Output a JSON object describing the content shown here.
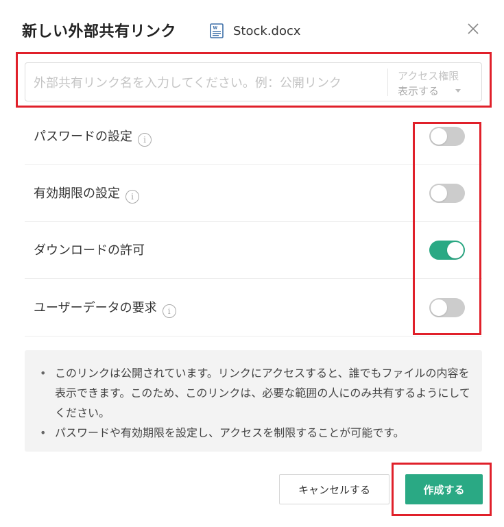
{
  "dialog": {
    "title": "新しい外部共有リンク",
    "file_name": "Stock.docx",
    "file_icon": "word-document-icon",
    "close_icon": "close-icon"
  },
  "link_name": {
    "value": "",
    "placeholder": "外部共有リンク名を入力してください。例：公開リンク",
    "access_label": "アクセス権限",
    "access_value": "表示する"
  },
  "settings": [
    {
      "label": "パスワードの設定",
      "info": true,
      "enabled": false
    },
    {
      "label": "有効期限の設定",
      "info": true,
      "enabled": false
    },
    {
      "label": "ダウンロードの許可",
      "info": false,
      "enabled": true
    },
    {
      "label": "ユーザーデータの要求",
      "info": true,
      "enabled": false
    }
  ],
  "info_glyph": "i",
  "notice": [
    "このリンクは公開されています。リンクにアクセスすると、誰でもファイルの内容を表示できます。このため、このリンクは、必要な範囲の人にのみ共有するようにしてください。",
    "パスワードや有効期限を設定し、アクセスを制限することが可能です。"
  ],
  "buttons": {
    "cancel": "キャンセルする",
    "create": "作成する"
  },
  "colors": {
    "accent": "#2aa984",
    "highlight": "#e0202a",
    "toggle_off": "#cccccc"
  }
}
